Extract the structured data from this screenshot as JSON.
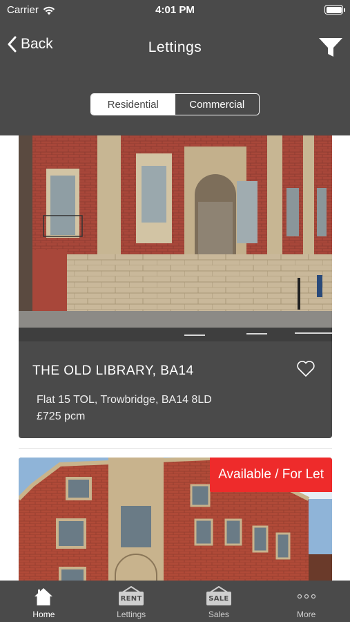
{
  "status_bar": {
    "carrier": "Carrier",
    "time": "4:01 PM"
  },
  "nav": {
    "back_label": "Back",
    "title": "Lettings"
  },
  "segments": {
    "residential": "Residential",
    "commercial": "Commercial",
    "selected": "Residential"
  },
  "listings": [
    {
      "name": "THE OLD LIBRARY, BA14",
      "address": "Flat 15 TOL, Trowbridge, BA14 8LD",
      "price": "£725 pcm"
    },
    {
      "badge": "Available / For Let"
    }
  ],
  "tabs": [
    {
      "label": "Home",
      "icon": "home-icon",
      "active": true
    },
    {
      "label": "Lettings",
      "icon": "rent-sign-icon",
      "sign_text": "RENT"
    },
    {
      "label": "Sales",
      "icon": "sale-sign-icon",
      "sign_text": "SALE"
    },
    {
      "label": "More",
      "icon": "more-dots-icon"
    }
  ],
  "colors": {
    "chrome": "#4a4a4a",
    "badge": "#ee2b2b",
    "white": "#ffffff"
  }
}
